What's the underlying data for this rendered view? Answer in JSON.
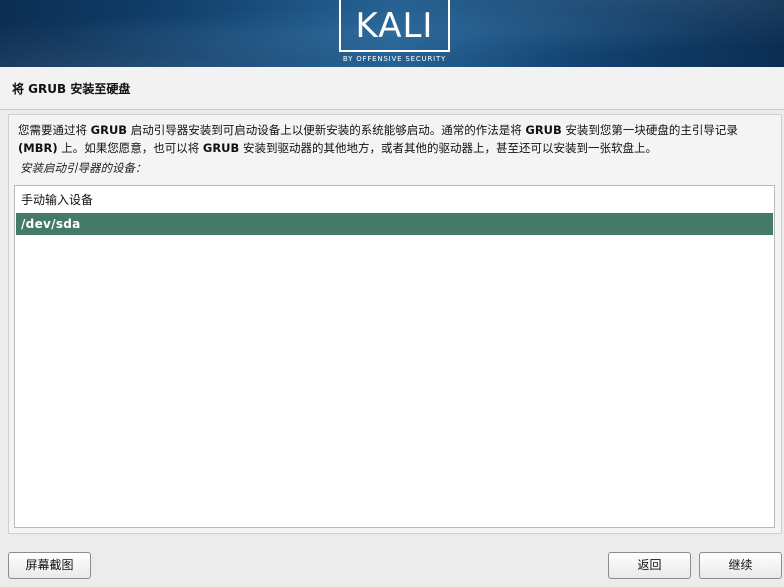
{
  "brand": {
    "logo_text": "KALI",
    "logo_subtitle": "BY OFFENSIVE SECURITY"
  },
  "page": {
    "title": "将 GRUB 安装至硬盘",
    "description_parts": [
      {
        "text": "您需要通过将 ",
        "bold": false
      },
      {
        "text": "GRUB",
        "bold": true
      },
      {
        "text": " 启动引导器安装到可启动设备上以便新安装的系统能够启动。通常的作法是将 ",
        "bold": false
      },
      {
        "text": "GRUB",
        "bold": true
      },
      {
        "text": " 安装到您第一块硬盘的主引导记录 ",
        "bold": false
      },
      {
        "text": "(MBR)",
        "bold": true
      },
      {
        "text": " 上。如果您愿意，也可以将 ",
        "bold": false
      },
      {
        "text": "GRUB",
        "bold": true
      },
      {
        "text": " 安装到驱动器的其他地方，或者其他的驱动器上，甚至还可以安装到一张软盘上。",
        "bold": false
      }
    ],
    "prompt": "安装启动引导器的设备："
  },
  "device_list": {
    "items": [
      {
        "label": "手动输入设备",
        "selected": false
      },
      {
        "label": "/dev/sda",
        "selected": true
      }
    ]
  },
  "buttons": {
    "screenshot": "屏幕截图",
    "back": "返回",
    "continue": "继续"
  },
  "colors": {
    "banner": "#12426f",
    "selected_row": "#45796a",
    "background": "#ececec"
  }
}
